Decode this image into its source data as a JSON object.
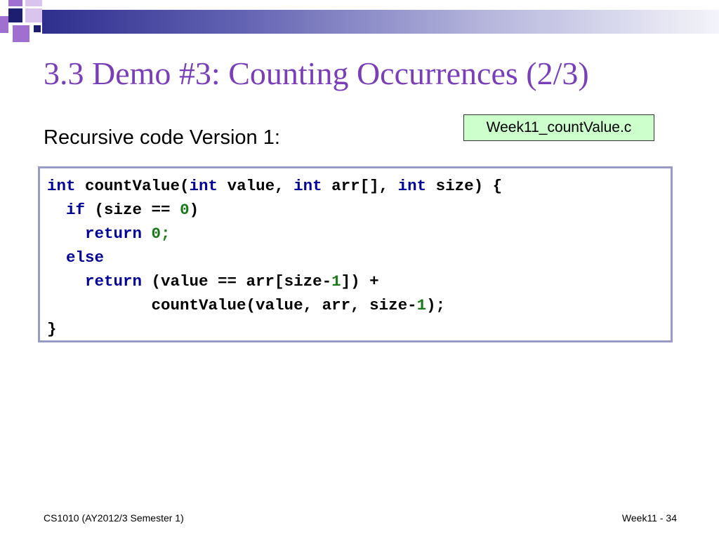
{
  "slide": {
    "title": "3.3 Demo #3: Counting Occurrences (2/3)",
    "subtitle": "Recursive code Version 1:",
    "filename_label": "Week11_countValue.c"
  },
  "code": {
    "line1": {
      "kw1": "int",
      "t1": " countValue(",
      "kw2": "int",
      "t2": " value, ",
      "kw3": "int",
      "t3": " arr[], ",
      "kw4": "int",
      "t4": " size) {"
    },
    "line2": {
      "indent": "  ",
      "kw1": "if",
      "t1": " (size == ",
      "n1": "0",
      "t2": ")"
    },
    "line3": {
      "indent": "    ",
      "kw1": "return",
      "t1": " ",
      "n1": "0;"
    },
    "line4": {
      "indent": "  ",
      "kw1": "else"
    },
    "line5": {
      "indent": "    ",
      "kw1": "return",
      "t1": " (value == arr[size-",
      "n1": "1",
      "t2": "]) +"
    },
    "line6": {
      "indent": "           ",
      "t1": "countValue(value, arr, size-",
      "n1": "1",
      "t2": ");"
    },
    "line7": {
      "t1": "}"
    }
  },
  "footer": {
    "course": "CS1010 (AY2012/3 Semester 1)",
    "page": "Week11 - 34"
  },
  "colors": {
    "title": "#7a3fb8",
    "keyword": "#000099",
    "number": "#1a7a1a",
    "filename_bg": "#ccffcc",
    "code_border": "#9a9ac6"
  }
}
